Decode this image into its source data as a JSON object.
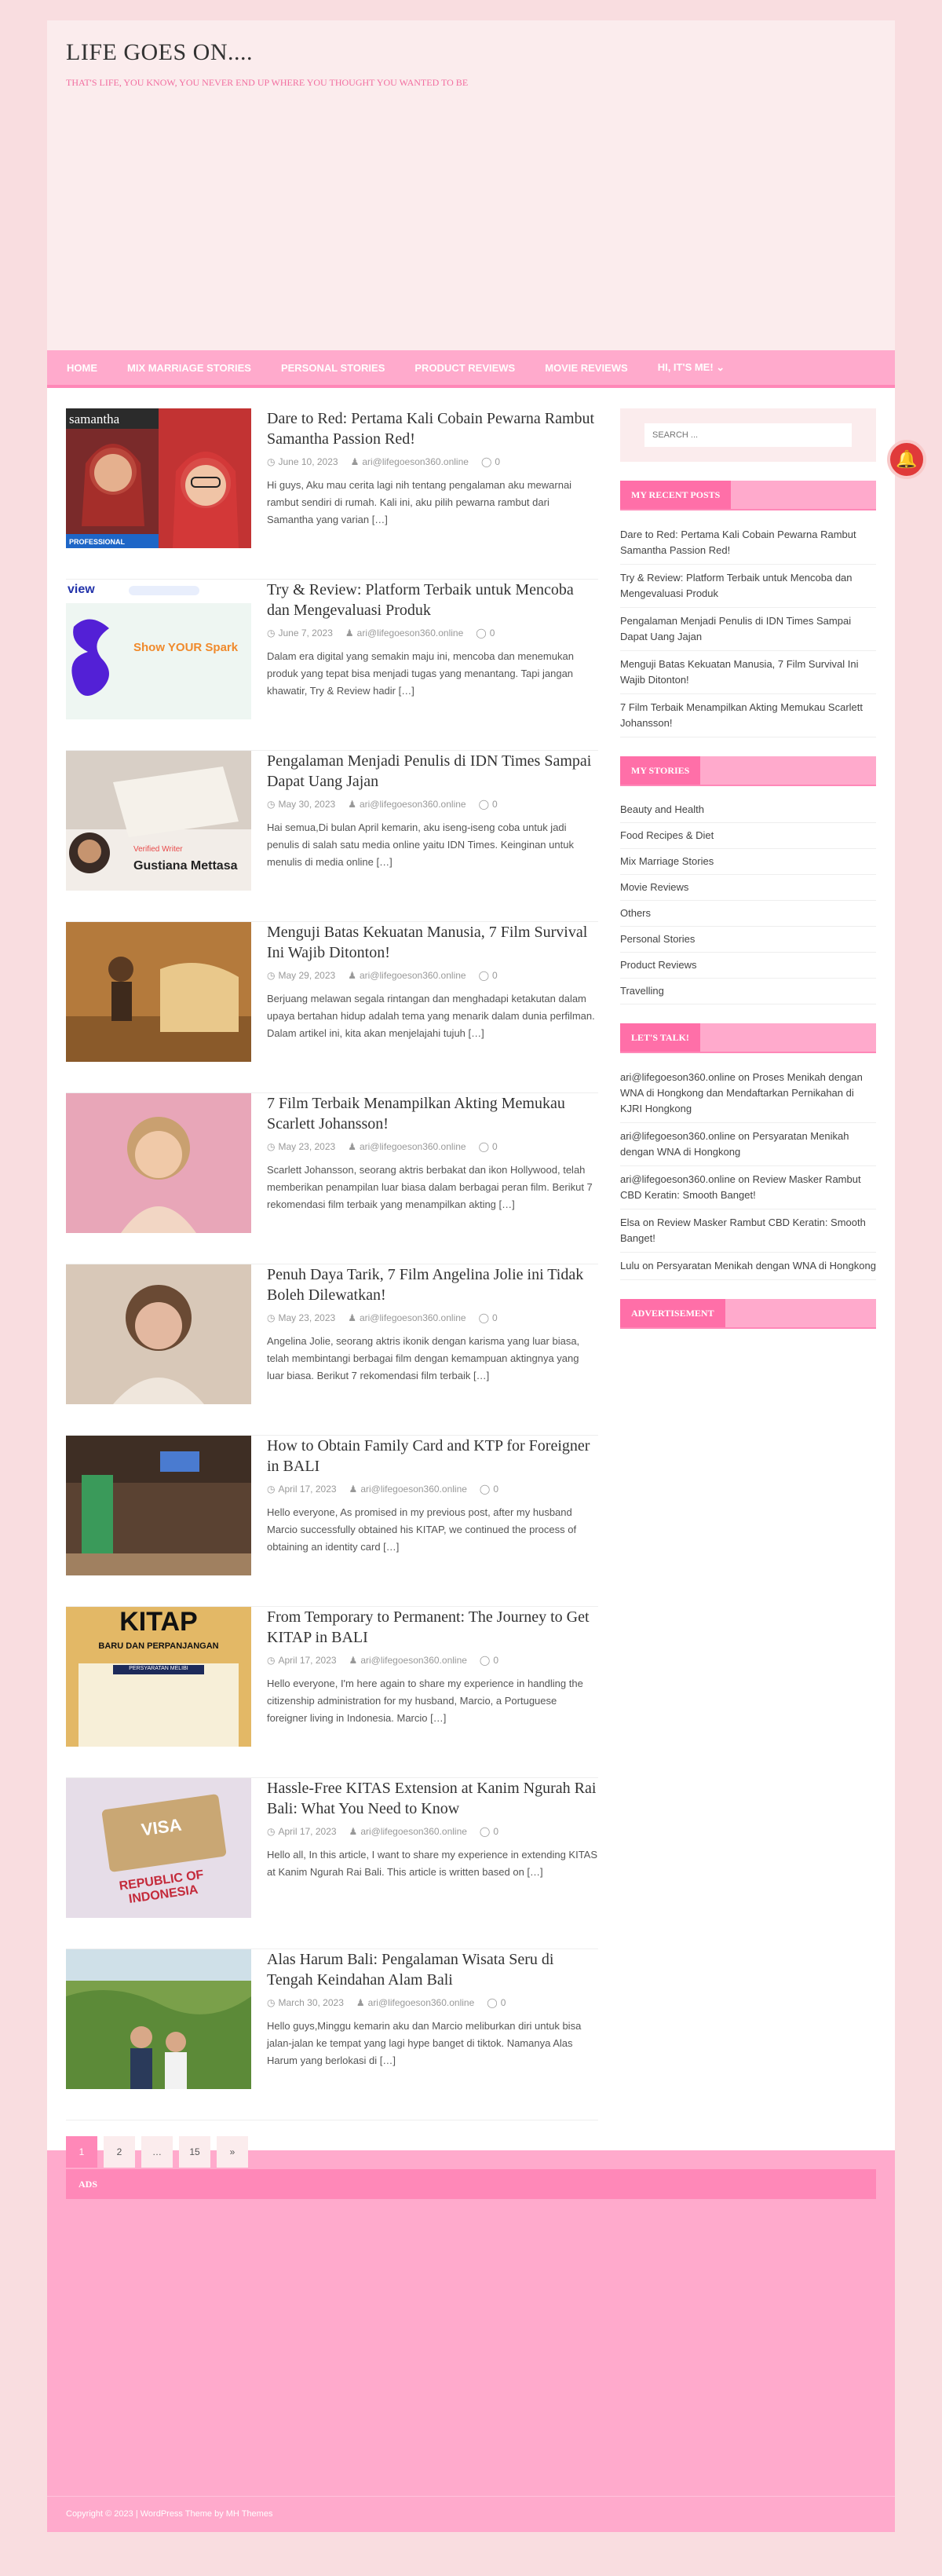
{
  "site": {
    "title": "LIFE GOES ON....",
    "tagline": "THAT'S LIFE, YOU KNOW, YOU NEVER END UP WHERE YOU THOUGHT YOU WANTED TO BE"
  },
  "nav": [
    "HOME",
    "MIX MARRIAGE STORIES",
    "PERSONAL STORIES",
    "PRODUCT REVIEWS",
    "MOVIE REVIEWS",
    "HI, IT'S ME! ⌄"
  ],
  "posts": [
    {
      "title": "Dare to Red: Pertama Kali Cobain Pewarna Rambut Samantha Passion Red!",
      "date": "June 10, 2023",
      "author": "ari@lifegoeson360.online",
      "comments": "0",
      "excerpt": "Hi guys, Aku mau cerita lagi nih tentang pengalaman aku mewarnai rambut sendiri di rumah. Kali ini, aku pilih pewarna rambut dari Samantha yang varian […]"
    },
    {
      "title": "Try & Review: Platform Terbaik untuk Mencoba dan Mengevaluasi Produk",
      "date": "June 7, 2023",
      "author": "ari@lifegoeson360.online",
      "comments": "0",
      "excerpt": "Dalam era digital yang semakin maju ini, mencoba dan menemukan produk yang tepat bisa menjadi tugas yang menantang. Tapi jangan khawatir, Try & Review hadir […]"
    },
    {
      "title": "Pengalaman Menjadi Penulis di IDN Times Sampai Dapat Uang Jajan",
      "date": "May 30, 2023",
      "author": "ari@lifegoeson360.online",
      "comments": "0",
      "excerpt": "Hai semua,Di bulan April kemarin, aku iseng-iseng coba untuk jadi penulis di salah satu media online yaitu IDN Times. Keinginan untuk menulis di media online […]"
    },
    {
      "title": "Menguji Batas Kekuatan Manusia, 7 Film Survival Ini Wajib Ditonton!",
      "date": "May 29, 2023",
      "author": "ari@lifegoeson360.online",
      "comments": "0",
      "excerpt": "Berjuang melawan segala rintangan dan menghadapi ketakutan dalam upaya bertahan hidup adalah tema yang menarik dalam dunia perfilman. Dalam artikel ini, kita akan menjelajahi tujuh […]"
    },
    {
      "title": "7 Film Terbaik Menampilkan Akting Memukau Scarlett Johansson!",
      "date": "May 23, 2023",
      "author": "ari@lifegoeson360.online",
      "comments": "0",
      "excerpt": "Scarlett Johansson, seorang aktris berbakat dan ikon Hollywood, telah memberikan penampilan luar biasa dalam berbagai peran film. Berikut 7 rekomendasi film terbaik yang menampilkan akting […]"
    },
    {
      "title": "Penuh Daya Tarik, 7 Film Angelina Jolie ini Tidak Boleh Dilewatkan!",
      "date": "May 23, 2023",
      "author": "ari@lifegoeson360.online",
      "comments": "0",
      "excerpt": "Angelina Jolie, seorang aktris ikonik dengan karisma yang luar biasa, telah membintangi berbagai film dengan kemampuan aktingnya yang luar biasa. Berikut 7 rekomendasi film terbaik […]"
    },
    {
      "title": "How to Obtain Family Card and KTP for Foreigner in BALI",
      "date": "April 17, 2023",
      "author": "ari@lifegoeson360.online",
      "comments": "0",
      "excerpt": "Hello everyone, As promised in my previous post, after my husband Marcio successfully obtained his KITAP, we continued the process of obtaining an identity card […]"
    },
    {
      "title": "From Temporary to Permanent: The Journey to Get KITAP in BALI",
      "date": "April 17, 2023",
      "author": "ari@lifegoeson360.online",
      "comments": "0",
      "excerpt": "Hello everyone, I'm here again to share my experience in handling the citizenship administration for my husband, Marcio, a Portuguese foreigner living in Indonesia. Marcio […]"
    },
    {
      "title": "Hassle-Free KITAS Extension at Kanim Ngurah Rai Bali: What You Need to Know",
      "date": "April 17, 2023",
      "author": "ari@lifegoeson360.online",
      "comments": "0",
      "excerpt": "Hello all, In this article, I want to share my experience in extending KITAS at Kanim Ngurah Rai Bali. This article is written based on […]"
    },
    {
      "title": "Alas Harum Bali: Pengalaman Wisata Seru di Tengah Keindahan Alam Bali",
      "date": "March 30, 2023",
      "author": "ari@lifegoeson360.online",
      "comments": "0",
      "excerpt": "Hello guys,Minggu kemarin aku dan Marcio meliburkan diri untuk bisa jalan-jalan ke tempat yang lagi hype banget di tiktok. Namanya Alas Harum yang berlokasi di […]"
    }
  ],
  "thumbs": {
    "t1_label": "samantha",
    "t1_sub": "PROFESSIONAL",
    "t2_label": "view",
    "t2_cta": "Show YOUR Spark",
    "t3_name": "Gustiana Mettasa",
    "t3_badge": "Verified Writer",
    "t8_title": "KITAP",
    "t8_sub": "BARU DAN PERPANJANGAN",
    "t8_req": "PERSYARATAN MELIBI",
    "t9_visa": "VISA",
    "t9_country": "REPUBLIC OF INDONESIA"
  },
  "pagination": [
    "1",
    "2",
    "…",
    "15",
    "»"
  ],
  "sidebar": {
    "search_placeholder": "SEARCH ...",
    "recent_title": "MY RECENT POSTS",
    "recent": [
      "Dare to Red: Pertama Kali Cobain Pewarna Rambut Samantha Passion Red!",
      "Try & Review: Platform Terbaik untuk Mencoba dan Mengevaluasi Produk",
      "Pengalaman Menjadi Penulis di IDN Times Sampai Dapat Uang Jajan",
      "Menguji Batas Kekuatan Manusia, 7 Film Survival Ini Wajib Ditonton!",
      "7 Film Terbaik Menampilkan Akting Memukau Scarlett Johansson!"
    ],
    "stories_title": "MY STORIES",
    "stories": [
      "Beauty and Health",
      "Food Recipes & Diet",
      "Mix Marriage Stories",
      "Movie Reviews",
      "Others",
      "Personal Stories",
      "Product Reviews",
      "Travelling"
    ],
    "talk_title": "LET'S TALK!",
    "comments": [
      "ari@lifegoeson360.online on Proses Menikah dengan WNA di Hongkong dan Mendaftarkan Pernikahan di KJRI Hongkong",
      "ari@lifegoeson360.online on Persyaratan Menikah dengan WNA di Hongkong",
      "ari@lifegoeson360.online on Review Masker Rambut CBD Keratin: Smooth Banget!",
      "Elsa on Review Masker Rambut CBD Keratin: Smooth Banget!",
      "Lulu on Persyaratan Menikah dengan WNA di Hongkong"
    ],
    "ad_title": "ADVERTISEMENT"
  },
  "footer": {
    "ads_title": "ADS",
    "copyright": "Copyright © 2023 | WordPress Theme by MH Themes"
  },
  "icons": {
    "calendar": "calendar-icon",
    "user": "user-icon",
    "comment": "comment-icon",
    "bell": "bell-icon"
  },
  "colors": {
    "page_bg": "#f9dde0",
    "header_bg": "#fbeced",
    "nav_bg": "#ffaacc",
    "accent": "#ff6fa8",
    "tagline": "#f26ea0"
  }
}
